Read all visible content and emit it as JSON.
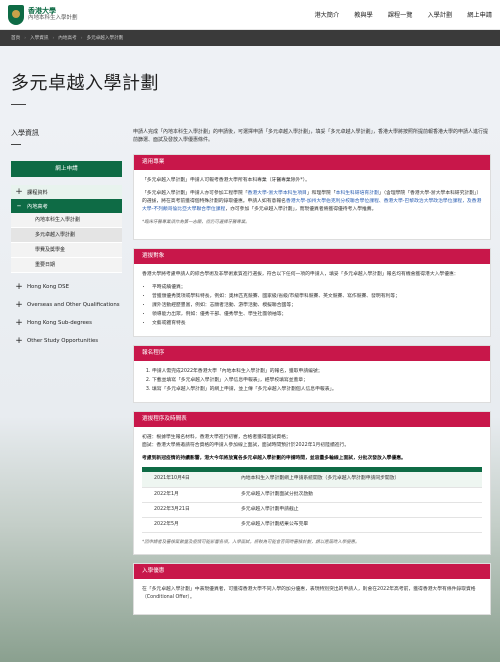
{
  "header": {
    "logo_title": "香港大學",
    "logo_sub": "內地本科生入學計劃",
    "nav": [
      "港大簡介",
      "教與學",
      "課程一覽",
      "入學計劃",
      "網上申請"
    ]
  },
  "breadcrumb": [
    "首頁",
    "入學資訊",
    "內地高考",
    "多元卓越入學計劃"
  ],
  "page_title": "多元卓越入學計劃",
  "sidebar": {
    "heading": "入學資訊",
    "online_button": "網上申請",
    "items": [
      {
        "label": "課程資料",
        "icon": "plus"
      },
      {
        "label": "內地高考",
        "icon": "minus"
      }
    ],
    "sub_items": [
      "內地本科生入學計劃",
      "多元卓越入學計劃",
      "學費及獎學金",
      "重要日期"
    ],
    "more_items": [
      "Hong Kong DSE",
      "Overseas and Other Qualifications",
      "Hong Kong Sub-degrees",
      "Other Study Opportunities"
    ]
  },
  "intro": "申請人完成「內地本科生入學計劃」的申請後，可選擇申請「多元卓越入學計劃」，填妥「多元卓越入學計劃」，香港大學將按照所提前報香港大學的申請人進行提前篩選、面試及發放入學優惠條件。",
  "cards": {
    "programs": {
      "title": "適用專業",
      "p1": "「多元卓越入學計劃」申請人可報考香港大學所有本科專業（牙醫專業除外*）。",
      "p2a": "「多元卓越入學計劃」申請人亦可參加工程學院「",
      "p2_link1": "香港大學-浙大學本科生項目",
      "p2b": "」和理學院「",
      "p2_link2": "本科生科研培育計劃",
      "p2c": "」（含理學院「香港大學-浙大學本科研究計劃」）的選拔，將在高考前獲得個特殊計劃的錄取優惠。申請人如有意報名",
      "p2_link3": "香港大學-加州大學伯克利分校聯合學位課程、香港大學-巴黎政治大學政治學位課程，及香港大學-不列顛哥倫比亞大學聯合學位課程",
      "p2d": "，亦可參加「多元卓越入學計劃」，而現優異者將獲得優待考入學推薦。",
      "note": "*臨床牙醫專業須作為第一志願，但仍可選擇牙醫專業。"
    },
    "targets": {
      "title": "選拔對象",
      "intro": "香港大學將考慮申請人的綜合學術及非學術素質進行選拔，符合以下任何一項的申請人，填妥「多元卓越入學計劃」報名均有機會獲得港大入學優惠：",
      "items": [
        "平時成績優異；",
        "曾獲頒優秀獎項或學科特長，例如：奧林匹克競賽、國家級/省級/市級學科競賽、英文競賽、寫作競賽、發明有利等；",
        "課外活動經歷豐富，例如：志願者活動、游學活動、模擬聯合國等；",
        "領導能力出眾，例如：優秀干部、優秀學生、學生社團領袖等；",
        "文藝或體育特長"
      ]
    },
    "procedure": {
      "title": "報名程序",
      "items": [
        "申請人需完成2022年香港大學「內地本科生入學計劃」的報名，獲取申請編號；",
        "下載並填寫「多元卓越入學計劃」入學信息申報表」，經學校填寫並蓋章；",
        "填寫「多元卓越入學計劃」的網上申請，並上傳「多元卓越入學計劃個人信息申報表」。"
      ]
    },
    "timeline": {
      "title": "選拔程序及時間表",
      "p1": "初選：根據學生報名材料，香港大學進行初審，合格者獲得面試資格；",
      "p2": "面試：香港大學將邀請符合資格的申請人參加線上面試，面試時間預計於2022年1月初陸續進行。",
      "bold": "考慮到新冠疫情的持續影響，港大今年將放寬各多元卓越入學計劃的申請時間，並容量多輪線上面試，分批次發放入學優惠。",
      "rows": [
        {
          "date": "2021年10月4日",
          "event": "內地本科生入學計劃網上申請系統開放（多元卓越入學計劃申請同步開放）"
        },
        {
          "date": "2022年1月",
          "event": "多元卓越入學計劃面試分批次啟動"
        },
        {
          "date": "2022年3月21日",
          "event": "多元卓越入學計劃申請截止"
        },
        {
          "date": "2022年5月",
          "event": "多元卓越入學計劃結果公布完畢"
        }
      ],
      "note": "*因申請者及審核案數量及疫情可能影響各項，入學面試，將較為可能會否同時審核計劃，請以應屆時入學優惠。"
    },
    "benefits": {
      "title": "入學優惠",
      "text": "在「多元卓越入學計劃」中表現優異者，可獲得香港大學不同入學的加分優惠，表現特別突出的申請人，則會在2022年高考前，獲得香港大學有條件錄取資格（Conditional Offer）。"
    }
  }
}
